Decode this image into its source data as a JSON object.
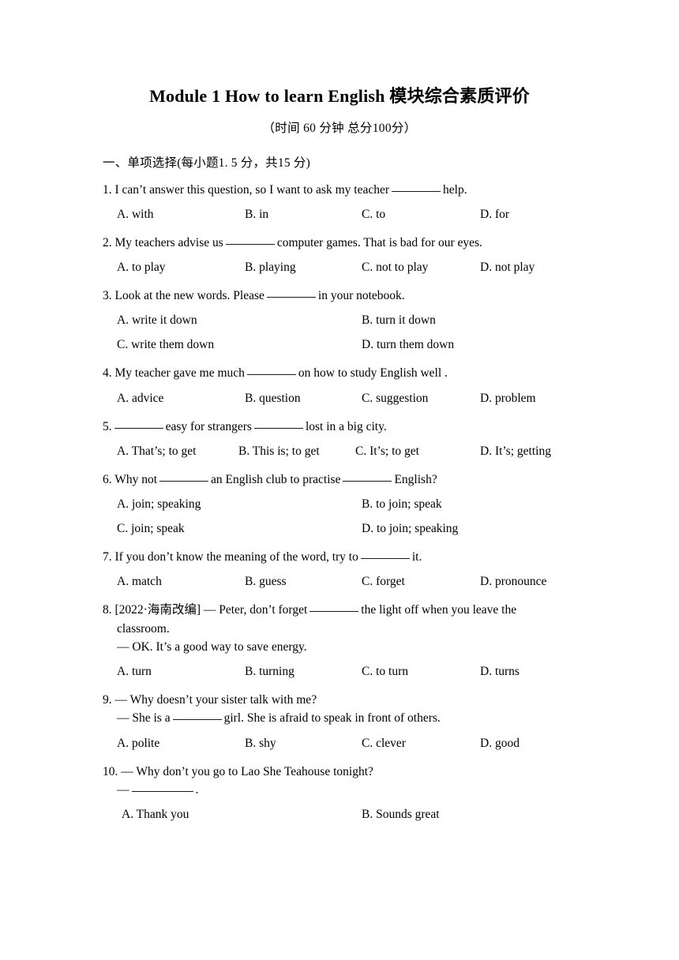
{
  "document": {
    "title": "Module 1 How to learn English 模块综合素质评价",
    "subtitle": "（时间 60 分钟 总分100分）",
    "section_heading": "一、单项选择(每小题1. 5 分，共15 分)"
  },
  "questions": [
    {
      "number": "1.",
      "stem_before": "1. I can’t answer this question, so I want to ask my teacher",
      "stem_after": "help.",
      "layout": "cols4",
      "options": [
        "A. with",
        "B. in",
        "C. to",
        "D. for"
      ]
    },
    {
      "number": "2.",
      "stem_before": "2. My teachers advise us",
      "stem_after": "computer games. That is bad for our eyes.",
      "layout": "cols4",
      "options": [
        "A. to play",
        "B. playing",
        "C. not to play",
        "D. not play"
      ]
    },
    {
      "number": "3.",
      "stem_before": "3. Look at the new words. Please",
      "stem_after": "in your notebook.",
      "layout": "cols2",
      "options": [
        "A. write it down",
        "B. turn it down",
        "C. write them down",
        "D. turn them down"
      ]
    },
    {
      "number": "4.",
      "stem_before": "4. My teacher gave me much",
      "stem_after": "on how to study English well .",
      "layout": "cols4",
      "options": [
        "A. advice",
        "B. question",
        "C. suggestion",
        "D. problem"
      ]
    },
    {
      "number": "5.",
      "stem_before": "5.",
      "stem_middle": "easy for strangers",
      "stem_after": "lost in a big city.",
      "layout": "cols4tight",
      "options": [
        "A. That’s; to get",
        "B. This is; to get",
        "C. It’s; to get",
        "D. It’s; getting"
      ]
    },
    {
      "number": "6.",
      "stem_before": "6. Why not",
      "stem_middle": "an English club to practise",
      "stem_after": "English?",
      "layout": "cols2",
      "options": [
        "A. join; speaking",
        "B. to join; speak",
        "C. join; speak",
        "D. to join; speaking"
      ]
    },
    {
      "number": "7.",
      "stem_before": "7. If you don’t know the meaning of the word, try to",
      "stem_after": "it.",
      "layout": "cols4",
      "options": [
        "A. match",
        "B. guess",
        "C. forget",
        "D. pronounce"
      ]
    },
    {
      "number": "8.",
      "tag": "8. [2022·海南改编] — Peter, don’t forget",
      "stem_after": "the light off when you leave the",
      "continuation": "classroom.",
      "reply": "— OK. It’s a good way to save energy.",
      "layout": "cols4",
      "options": [
        "A. turn",
        "B. turning",
        "C. to turn",
        "D. turns"
      ]
    },
    {
      "number": "9.",
      "stem_before": "9. — Why doesn’t your sister talk with me?",
      "reply_before": "— She is a",
      "reply_after": "girl. She is afraid to speak in front of others.",
      "layout": "cols4",
      "options": [
        "A. polite",
        "B. shy",
        "C. clever",
        "D. good"
      ]
    },
    {
      "number": "10.",
      "stem_before": "10. — Why don’t you go to Lao She Teahouse tonight?",
      "reply_before": "—",
      "reply_after": ".",
      "layout": "cols2b",
      "options": [
        "A. Thank you",
        "B. Sounds great"
      ]
    }
  ]
}
